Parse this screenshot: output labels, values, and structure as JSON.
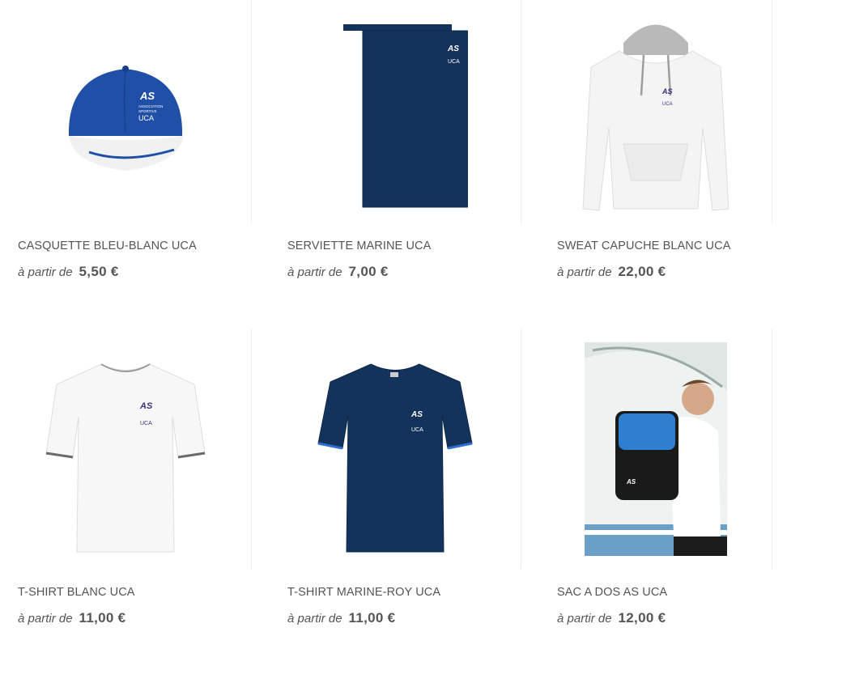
{
  "products": [
    {
      "title": "CASQUETTE BLEU-BLANC UCA",
      "from_label": "à partir de",
      "price": "5,50 €",
      "image": "cap-image"
    },
    {
      "title": "SERVIETTE MARINE UCA",
      "from_label": "à partir de",
      "price": "7,00 €",
      "image": "towel-image"
    },
    {
      "title": "SWEAT CAPUCHE BLANC UCA",
      "from_label": "à partir de",
      "price": "22,00 €",
      "image": "hoodie-image"
    },
    {
      "title": "T-SHIRT BLANC UCA",
      "from_label": "à partir de",
      "price": "11,00 €",
      "image": "white-tshirt-image"
    },
    {
      "title": "T-SHIRT MARINE-ROY UCA",
      "from_label": "à partir de",
      "price": "11,00 €",
      "image": "navy-tshirt-image"
    },
    {
      "title": "SAC A DOS AS UCA",
      "from_label": "à partir de",
      "price": "12,00 €",
      "image": "backpack-image"
    }
  ],
  "logo": {
    "mark": "AS",
    "line1": "ASSOCIATION",
    "line2": "SPORTIVE",
    "line3": "UCA"
  },
  "colors": {
    "royal": "#1f4fa6",
    "navy": "#14335c",
    "text": "#555555",
    "logo_purple": "#3a2f7a"
  }
}
